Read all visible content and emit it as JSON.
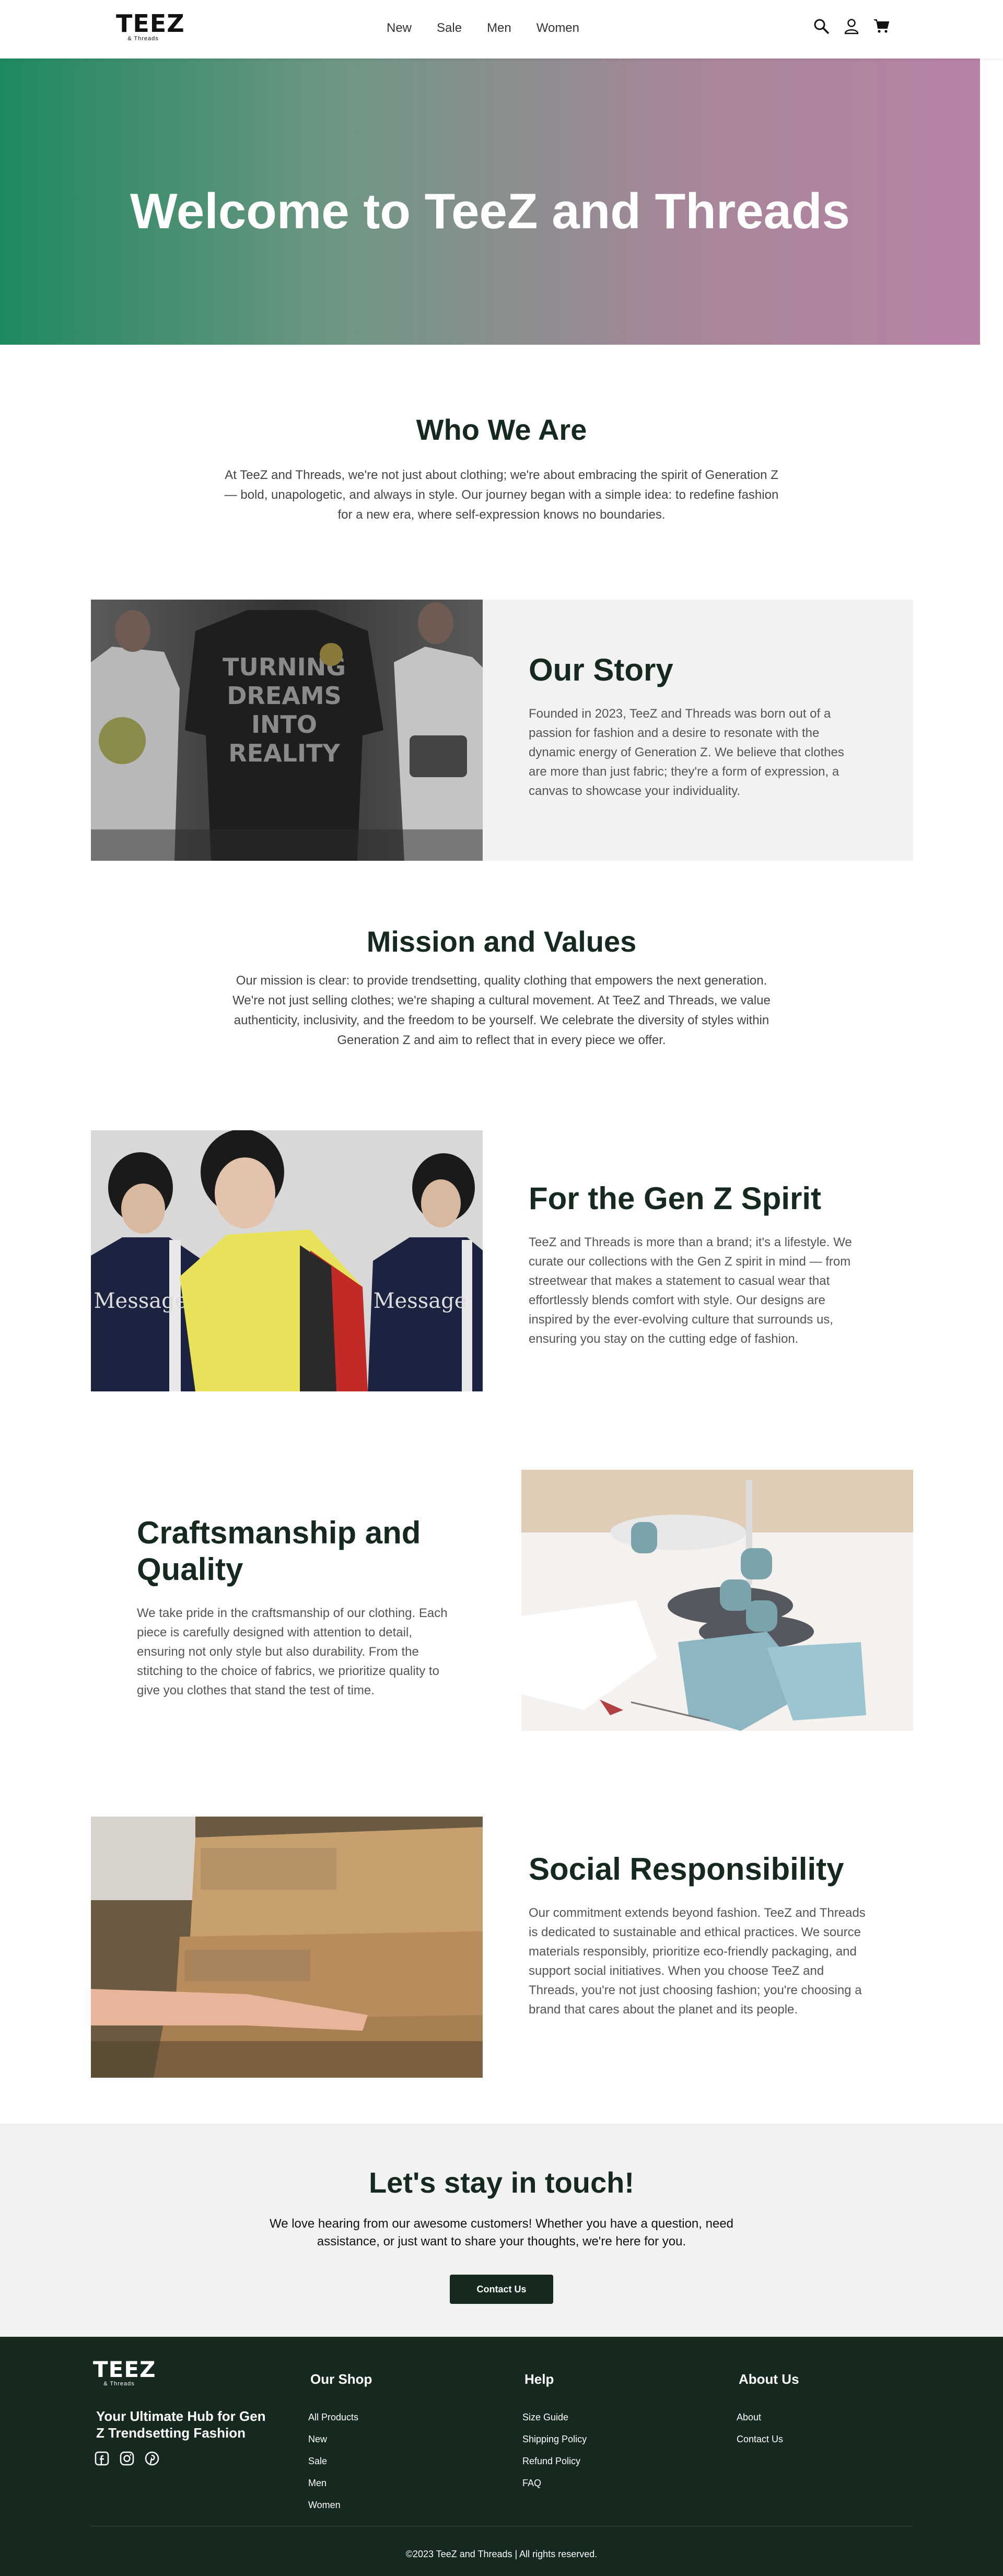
{
  "header": {
    "logo_main": "TEEZ",
    "logo_sub": "& Threads",
    "nav": [
      "New",
      "Sale",
      "Men",
      "Women"
    ],
    "icons": [
      "search-icon",
      "user-icon",
      "cart-icon"
    ]
  },
  "hero": {
    "title": "Welcome to TeeZ and Threads"
  },
  "who": {
    "title": "Who We Are",
    "text": "At TeeZ and Threads, we're not just about clothing; we're about embracing the spirit of Generation Z — bold, unapologetic, and always in style. Our journey began with a simple idea: to redefine fashion for a new era, where self-expression knows no boundaries."
  },
  "story": {
    "title": "Our Story",
    "text": "Founded in 2023, TeeZ and Threads was born out of a passion for fashion and a desire to resonate with the dynamic energy of Generation Z. We believe that clothes are more than just fabric; they're a form of expression, a canvas to showcase your individuality.",
    "image_shirt_text": [
      "TURNING",
      "DREAMS",
      "INTO",
      "REALITY"
    ]
  },
  "mission": {
    "title": "Mission and Values",
    "text": "Our mission is clear: to provide trendsetting, quality clothing that empowers the next generation. We're not just selling clothes; we're shaping a cultural movement. At TeeZ and Threads, we value authenticity, inclusivity, and the freedom to be yourself. We celebrate the diversity of styles within Generation Z and aim to reflect that in every piece we offer."
  },
  "genz": {
    "title": "For the Gen Z Spirit",
    "text": "TeeZ and Threads is more than a brand; it's a lifestyle. We curate our collections with the Gen Z spirit in mind — from streetwear that makes a statement to casual wear that effortlessly blends comfort with style. Our designs are inspired by the ever-evolving culture that surrounds us, ensuring you stay on the cutting edge of fashion."
  },
  "craft": {
    "title": "Craftsmanship and Quality",
    "text": "We take pride in the craftsmanship of our clothing. Each piece is carefully designed with attention to detail, ensuring not only style but also durability. From the stitching to the choice of fabrics, we prioritize quality to give you clothes that stand the test of time."
  },
  "social": {
    "title": "Social Responsibility",
    "text": "Our commitment extends beyond fashion. TeeZ and Threads is dedicated to sustainable and ethical practices. We source materials responsibly, prioritize eco-friendly packaging, and support social initiatives. When you choose TeeZ and Threads, you're not just choosing fashion; you're choosing a brand that cares about the planet and its people."
  },
  "touch": {
    "title": "Let's stay in touch!",
    "text": "We love hearing from our awesome customers! Whether you have a question, need assistance, or just want to share your thoughts, we're here for you.",
    "button": "Contact Us"
  },
  "footer": {
    "logo_main": "TEEZ",
    "logo_sub": "& Threads",
    "tagline": "Your Ultimate Hub for Gen Z Trendsetting Fashion",
    "social": [
      "facebook-icon",
      "instagram-icon",
      "pinterest-icon"
    ],
    "columns": [
      {
        "title": "Our Shop",
        "items": [
          "All Products",
          "New",
          "Sale",
          "Men",
          "Women"
        ]
      },
      {
        "title": "Help",
        "items": [
          "Size Guide",
          "Shipping Policy",
          "Refund Policy",
          "FAQ"
        ]
      },
      {
        "title": "About Us",
        "items": [
          "About",
          "Contact Us"
        ]
      }
    ],
    "copyright": "©2023 TeeZ and Threads | All rights reserved."
  },
  "colors": {
    "brand_dark": "#15291f",
    "hero_left": "#1f8a5f",
    "hero_right": "#b882a5"
  }
}
